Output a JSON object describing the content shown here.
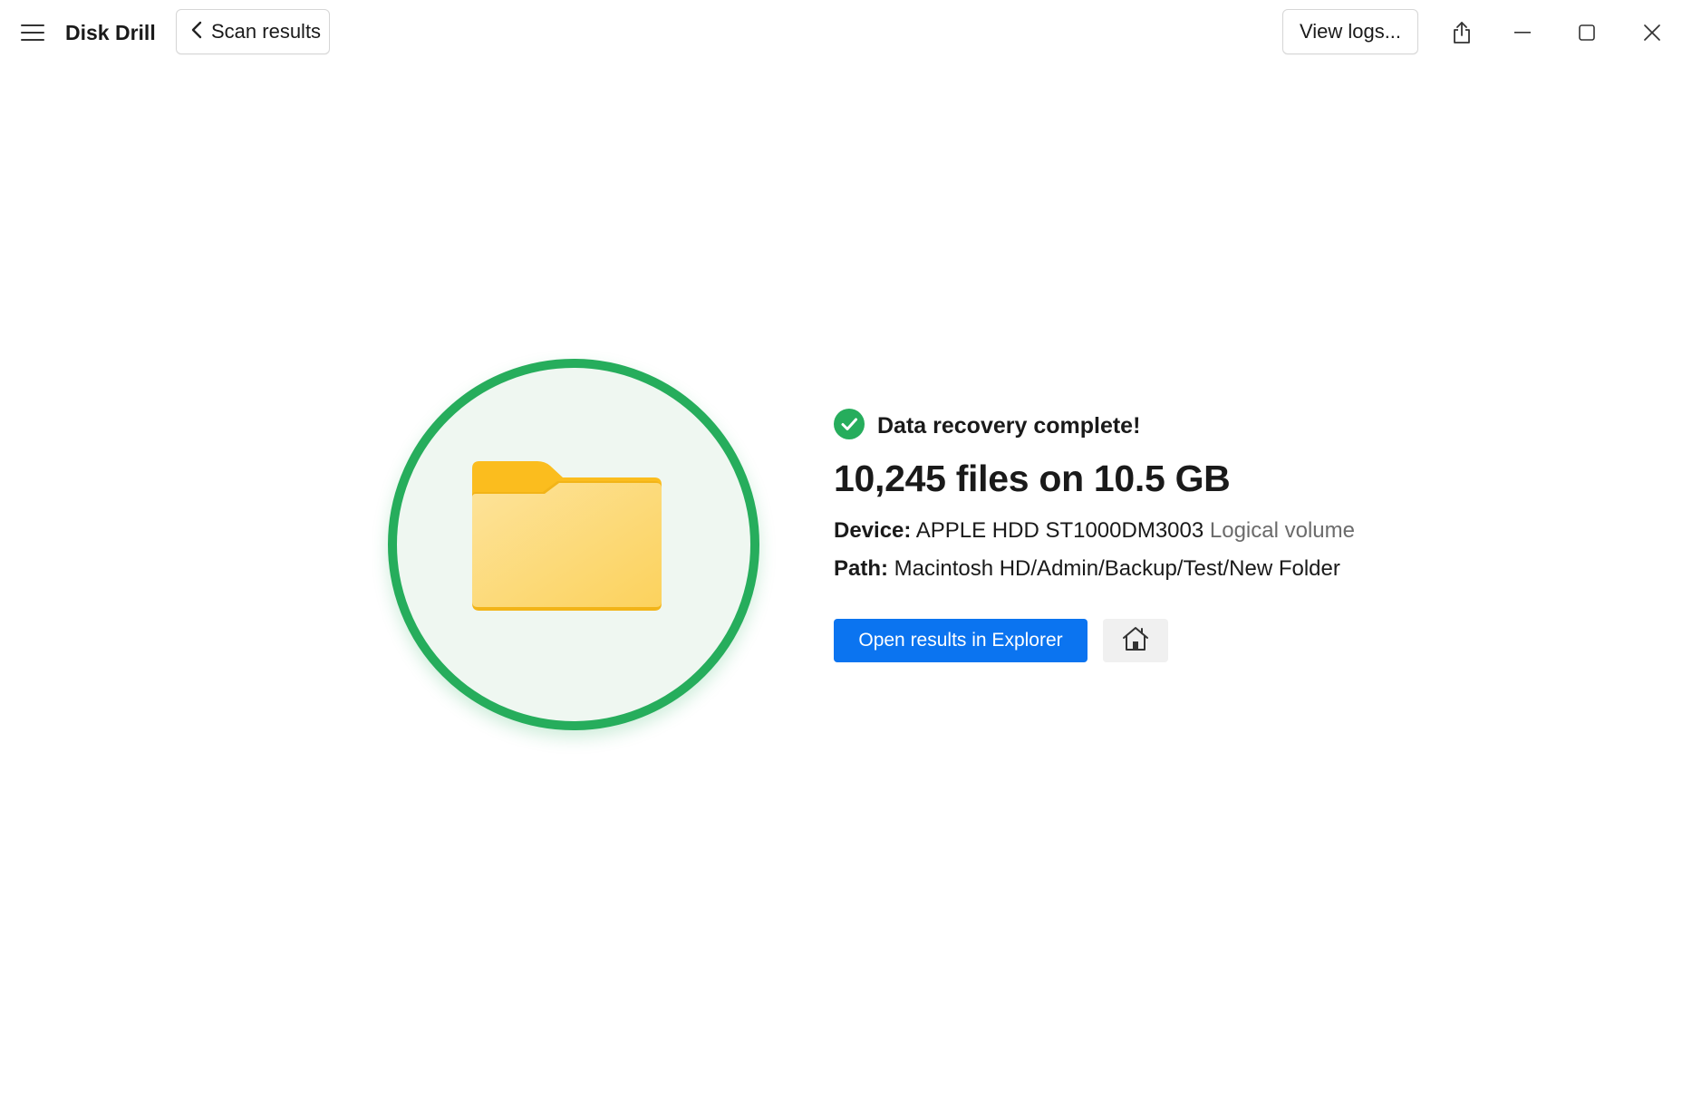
{
  "app": {
    "title": "Disk Drill"
  },
  "header": {
    "back_label": "Scan results",
    "logs_label": "View logs..."
  },
  "icons": {
    "menu": "hamburger-menu-icon",
    "back": "chevron-left-icon",
    "share": "share-icon",
    "minimize": "minimize-icon",
    "maximize": "maximize-icon",
    "close": "close-icon",
    "status": "check-circle-icon",
    "folder": "folder-icon",
    "home": "home-icon"
  },
  "colors": {
    "accent_green": "#26ad5c",
    "primary_blue": "#0b74f0",
    "folder_yellow": "#fbbd1e"
  },
  "result": {
    "status": "Data recovery complete!",
    "headline": "10,245 files on 10.5 GB",
    "device_key": "Device:",
    "device_value": "APPLE HDD ST1000DM3003",
    "device_type": "Logical volume",
    "path_key": "Path:",
    "path_value": "Macintosh HD/Admin/Backup/Test/New Folder"
  },
  "actions": {
    "open_label": "Open results in Explorer"
  }
}
